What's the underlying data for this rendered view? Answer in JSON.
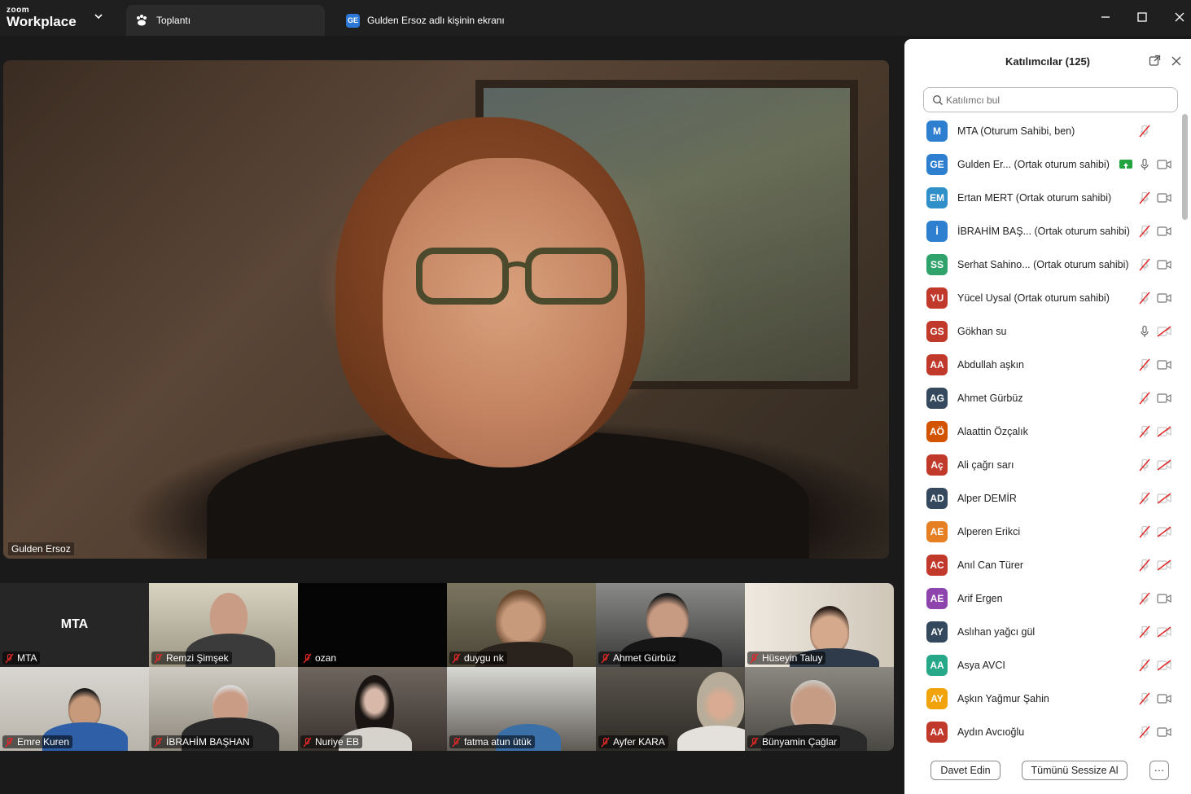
{
  "app": {
    "brand_small": "zoom",
    "brand_large": "Workplace"
  },
  "tabs": [
    {
      "label": "Toplantı",
      "icon": "meeting-paw-icon",
      "active": true
    },
    {
      "label": "Gulden Ersoz adlı kişinin ekranı",
      "badge": "GE",
      "active": false
    }
  ],
  "main_video": {
    "name": "Gulden Ersoz"
  },
  "gallery": [
    {
      "name": "MTA",
      "initials": "MTA",
      "muted": true,
      "video": false
    },
    {
      "name": "Remzi Şimşek",
      "muted": true,
      "video": true
    },
    {
      "name": "ozan",
      "muted": true,
      "video": false
    },
    {
      "name": "duygu nk",
      "muted": true,
      "video": true
    },
    {
      "name": "Ahmet Gürbüz",
      "muted": true,
      "video": true
    },
    {
      "name": "Hüseyin Taluy",
      "muted": true,
      "video": true
    },
    {
      "name": "Emre Kuren",
      "muted": true,
      "video": true
    },
    {
      "name": "İBRAHİM BAŞHAN",
      "muted": true,
      "video": true
    },
    {
      "name": "Nuriye EB",
      "muted": true,
      "video": true
    },
    {
      "name": "fatma atun ütük",
      "muted": true,
      "video": true
    },
    {
      "name": "Ayfer KARA",
      "muted": true,
      "video": true
    },
    {
      "name": "Bünyamin Çağlar",
      "muted": true,
      "video": true
    }
  ],
  "participants_panel": {
    "title": "Katılımcılar (125)",
    "search_placeholder": "Katılımcı bul",
    "participants": [
      {
        "initials": "M",
        "name": "MTA (Oturum Sahibi, ben)",
        "color": "#2f7fd1",
        "mic": "muted",
        "cam": "none"
      },
      {
        "initials": "GE",
        "name": "Gulden Er... (Ortak oturum sahibi)",
        "color": "#2f7fd1",
        "mic": "on",
        "cam": "on",
        "sharing": true
      },
      {
        "initials": "EM",
        "name": "Ertan MERT (Ortak oturum sahibi)",
        "color": "#2f8fc9",
        "mic": "muted",
        "cam": "on"
      },
      {
        "initials": "İ",
        "name": "İBRAHİM BAŞ...  (Ortak oturum sahibi)",
        "color": "#2f7fd1",
        "mic": "muted",
        "cam": "on"
      },
      {
        "initials": "SS",
        "name": "Serhat Sahino... (Ortak oturum sahibi)",
        "color": "#2fa36b",
        "mic": "muted",
        "cam": "on"
      },
      {
        "initials": "YU",
        "name": "Yücel Uysal (Ortak oturum sahibi)",
        "color": "#c0392b",
        "mic": "muted",
        "cam": "on"
      },
      {
        "initials": "GS",
        "name": "Gökhan su",
        "color": "#c0392b",
        "mic": "on",
        "cam": "off"
      },
      {
        "initials": "AA",
        "name": "Abdullah aşkın",
        "color": "#c0392b",
        "mic": "muted",
        "cam": "on"
      },
      {
        "initials": "AG",
        "name": "Ahmet Gürbüz",
        "color": "#34495e",
        "mic": "muted",
        "cam": "on"
      },
      {
        "initials": "AÖ",
        "name": "Alaattin Özçalık",
        "color": "#d35400",
        "mic": "muted",
        "cam": "off"
      },
      {
        "initials": "Aç",
        "name": "Ali çağrı sarı",
        "color": "#c0392b",
        "mic": "muted",
        "cam": "off"
      },
      {
        "initials": "AD",
        "name": "Alper DEMİR",
        "color": "#34495e",
        "mic": "muted",
        "cam": "off"
      },
      {
        "initials": "AE",
        "name": "Alperen Erikci",
        "color": "#e67e22",
        "mic": "muted",
        "cam": "off"
      },
      {
        "initials": "AC",
        "name": "Anıl Can Türer",
        "color": "#c0392b",
        "mic": "muted",
        "cam": "off"
      },
      {
        "initials": "AE",
        "name": "Arif Ergen",
        "color": "#8e44ad",
        "mic": "muted",
        "cam": "on"
      },
      {
        "initials": "AY",
        "name": "Aslıhan yağcı gül",
        "color": "#34495e",
        "mic": "muted",
        "cam": "off"
      },
      {
        "initials": "AA",
        "name": "Asya AVCI",
        "color": "#27a889",
        "mic": "muted",
        "cam": "off"
      },
      {
        "initials": "AY",
        "name": "Aşkın Yağmur Şahin",
        "color": "#f0a30a",
        "mic": "muted",
        "cam": "on"
      },
      {
        "initials": "AA",
        "name": "Aydın Avcıoğlu",
        "color": "#c0392b",
        "mic": "muted",
        "cam": "on"
      }
    ],
    "footer": {
      "invite": "Davet Edin",
      "mute_all": "Tümünü Sessize Al",
      "more": "···"
    }
  }
}
